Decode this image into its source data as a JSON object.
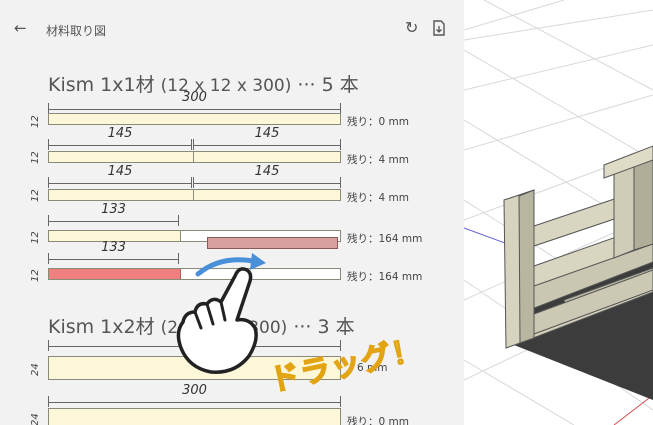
{
  "appbar": {
    "back_icon": "arrow-left-icon",
    "title": "材料取り図",
    "refresh_icon": "refresh-icon",
    "export_icon": "export-icon"
  },
  "sections": [
    {
      "title": "Kism 1x1材",
      "spec": "(12 x 12 x 300)",
      "count": "··· 5 本"
    },
    {
      "title": "Kism 1x2材",
      "spec": "(2",
      "spec_end": "300)",
      "count": "··· 3 本"
    }
  ],
  "bars": [
    {
      "side": "12",
      "cuts": [
        "300"
      ],
      "remain": "残り：0 mm"
    },
    {
      "side": "12",
      "cuts": [
        "145",
        "145"
      ],
      "remain": "残り：4 mm"
    },
    {
      "side": "12",
      "cuts": [
        "145",
        "145"
      ],
      "remain": "残り：4 mm"
    },
    {
      "side": "12",
      "cuts": [
        "133"
      ],
      "remain": "残り：164 mm"
    },
    {
      "side": "12",
      "cuts": [
        "133"
      ],
      "remain": "残り：164 mm"
    },
    {
      "side": "24",
      "cuts": [
        ""
      ],
      "remain": "6 mm"
    },
    {
      "side": "24",
      "cuts": [
        "300"
      ],
      "remain": "残り：0 mm"
    }
  ],
  "overlay": {
    "drag_text": "ドラッグ！"
  },
  "colors": {
    "panel_bg": "#f2f2f2",
    "bar_fill": "#fbf7d8",
    "selected_fill": "#f08080",
    "accent": "#4a90d9",
    "drag_text": "#f7d548"
  }
}
